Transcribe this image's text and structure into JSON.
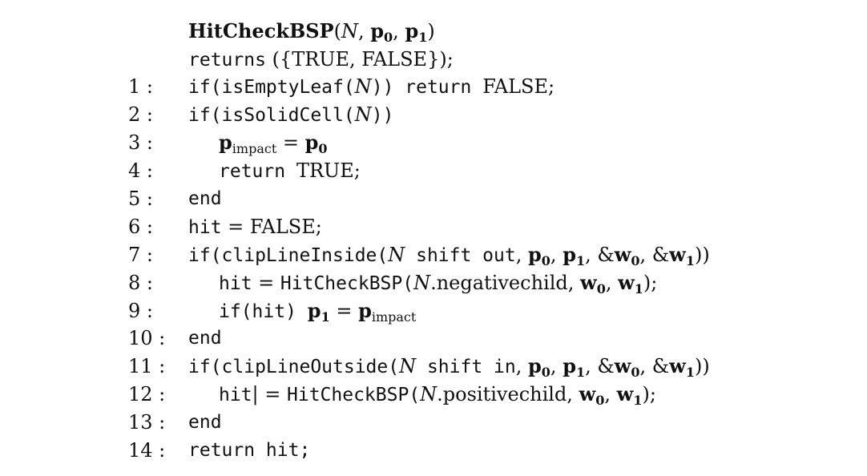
{
  "header": {
    "signature": "HitCheckBSP(N, p0, p1)",
    "returns": "returns ({TRUE, FALSE});"
  },
  "lines": [
    {
      "num": "1 :",
      "code": "if(isEmptyLeaf(N)) return FALSE;"
    },
    {
      "num": "2 :",
      "code": "if(isSolidCell(N))"
    },
    {
      "num": "3 :",
      "code": "p_impact = p0"
    },
    {
      "num": "4 :",
      "code": "return TRUE;"
    },
    {
      "num": "5 :",
      "code": "end"
    },
    {
      "num": "6 :",
      "code": "hit = FALSE;"
    },
    {
      "num": "7 :",
      "code": "if(clipLineInside(N shift out, p0, p1, &w0, &w1))"
    },
    {
      "num": "8 :",
      "code": "hit = HitCheckBSP(N.negativechild, w0, w1);"
    },
    {
      "num": "9 :",
      "code": "if(hit) p1 = p_impact"
    },
    {
      "num": "10 :",
      "code": "end"
    },
    {
      "num": "11 :",
      "code": "if(clipLineOutside(N shift in, p0, p1, &w0, &w1))"
    },
    {
      "num": "12 :",
      "code": "hit| = HitCheckBSP(N.positivechild, w0, w1);"
    },
    {
      "num": "13 :",
      "code": "end"
    },
    {
      "num": "14 :",
      "code": "return hit;"
    }
  ]
}
